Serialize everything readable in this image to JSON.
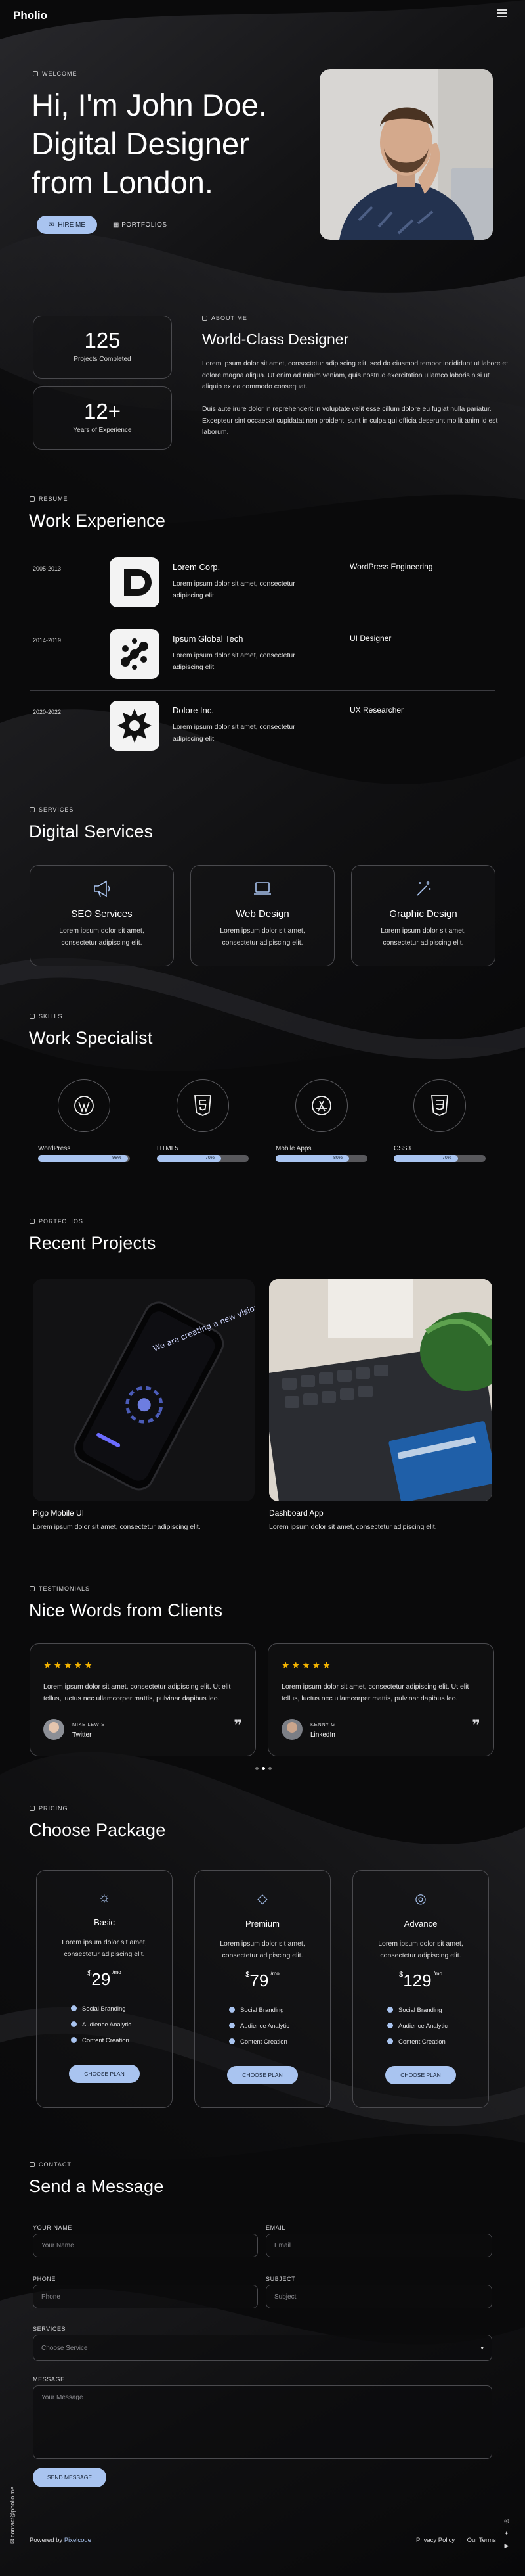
{
  "brand": "Pholio",
  "hero": {
    "label": "WELCOME",
    "line1": "Hi, I'm John Doe.",
    "line2": "Digital Designer",
    "line3": "from London.",
    "hire_btn": "HIRE ME",
    "portfolio_link": "PORTFOLIOS"
  },
  "about": {
    "label": "ABOUT ME",
    "title": "World-Class Designer",
    "stats": [
      {
        "num": "125",
        "text": "Projects Completed"
      },
      {
        "num": "12+",
        "text": "Years of Experience"
      }
    ],
    "p1": "Lorem ipsum dolor sit amet, consectetur adipiscing elit, sed do eiusmod tempor incididunt ut labore et dolore magna aliqua. Ut enim ad minim veniam, quis nostrud exercitation ullamco laboris nisi ut aliquip ex ea commodo consequat.",
    "p2": "Duis aute irure dolor in reprehenderit in voluptate velit esse cillum dolore eu fugiat nulla pariatur. Excepteur sint occaecat cupidatat non proident, sunt in culpa qui officia deserunt mollit anim id est laborum."
  },
  "resume": {
    "label": "RESUME",
    "title": "Work Experience",
    "items": [
      {
        "years": "2005-2013",
        "company": "Lorem Corp.",
        "desc": "Lorem ipsum dolor sit amet, consectetur adipiscing elit.",
        "role": "WordPress Engineering"
      },
      {
        "years": "2014-2019",
        "company": "Ipsum Global Tech",
        "desc": "Lorem ipsum dolor sit amet, consectetur adipiscing elit.",
        "role": "UI Designer"
      },
      {
        "years": "2020-2022",
        "company": "Dolore Inc.",
        "desc": "Lorem ipsum dolor sit amet, consectetur adipiscing elit.",
        "role": "UX Researcher"
      }
    ]
  },
  "services": {
    "label": "SERVICES",
    "title": "Digital Services",
    "items": [
      {
        "icon": "megaphone-icon",
        "name": "SEO Services",
        "desc": "Lorem ipsum dolor sit amet, consectetur adipiscing elit."
      },
      {
        "icon": "laptop-icon",
        "name": "Web Design",
        "desc": "Lorem ipsum dolor sit amet, consectetur adipiscing elit."
      },
      {
        "icon": "magic-wand-icon",
        "name": "Graphic Design",
        "desc": "Lorem ipsum dolor sit amet, consectetur adipiscing elit."
      }
    ]
  },
  "skills": {
    "label": "SKILLS",
    "title": "Work Specialist",
    "items": [
      {
        "icon": "wordpress-icon",
        "name": "WordPress",
        "pct": "98%",
        "value": 0.98
      },
      {
        "icon": "html5-icon",
        "name": "HTML5",
        "pct": "70%",
        "value": 0.7
      },
      {
        "icon": "app-store-icon",
        "name": "Mobile Apps",
        "pct": "80%",
        "value": 0.8
      },
      {
        "icon": "css3-icon",
        "name": "CSS3",
        "pct": "70%",
        "value": 0.7
      }
    ]
  },
  "portfolio": {
    "label": "PORTFOLIOS",
    "title": "Recent Projects",
    "items": [
      {
        "name": "Pigo Mobile UI",
        "desc": "Lorem ipsum dolor sit amet, consectetur adipiscing elit.",
        "phone_text": "We are creating a new vision for your products!"
      },
      {
        "name": "Dashboard App",
        "desc": "Lorem ipsum dolor sit amet, consectetur adipiscing elit."
      }
    ]
  },
  "testimonials": {
    "label": "TESTIMONIALS",
    "title": "Nice Words from Clients",
    "items": [
      {
        "stars": "★★★★★",
        "text": "Lorem ipsum dolor sit amet, consectetur adipiscing elit. Ut elit tellus, luctus nec ullamcorper mattis, pulvinar dapibus leo.",
        "name": "MIKE LEWIS",
        "company": "Twitter"
      },
      {
        "stars": "★★★★★",
        "text": "Lorem ipsum dolor sit amet, consectetur adipiscing elit. Ut elit tellus, luctus nec ullamcorper mattis, pulvinar dapibus leo.",
        "name": "KENNY G",
        "company": "LinkedIn"
      }
    ],
    "quote_glyph": "❞"
  },
  "pricing": {
    "label": "PRICING",
    "title": "Choose Package",
    "plans": [
      {
        "icon": "bulb-icon",
        "name": "Basic",
        "desc": "Lorem ipsum dolor sit amet, consectetur adipiscing elit.",
        "currency": "$",
        "price": "29",
        "period": "/mo",
        "features": [
          "Social Branding",
          "Audience Analytic",
          "Content Creation"
        ],
        "button": "CHOOSE PLAN"
      },
      {
        "icon": "diamond-icon",
        "name": "Premium",
        "desc": "Lorem ipsum dolor sit amet, consectetur adipiscing elit.",
        "currency": "$",
        "price": "79",
        "period": "/mo",
        "features": [
          "Social Branding",
          "Audience Analytic",
          "Content Creation"
        ],
        "button": "CHOOSE PLAN"
      },
      {
        "icon": "globe-icon",
        "name": "Advance",
        "desc": "Lorem ipsum dolor sit amet, consectetur adipiscing elit.",
        "currency": "$",
        "price": "129",
        "period": "/mo",
        "features": [
          "Social Branding",
          "Audience Analytic",
          "Content Creation"
        ],
        "button": "CHOOSE PLAN"
      }
    ]
  },
  "contact": {
    "label": "CONTACT",
    "title": "Send a Message",
    "name_label": "YOUR NAME",
    "name_ph": "Your Name",
    "email_label": "EMAIL",
    "email_ph": "Email",
    "phone_label": "PHONE",
    "phone_ph": "Phone",
    "subject_label": "SUBJECT",
    "subject_ph": "Subject",
    "services_label": "SERVICES",
    "services_ph": "Choose Service",
    "message_label": "MESSAGE",
    "message_ph": "Your Message",
    "send_btn": "SEND MESSAGE"
  },
  "sidebar_email": "contact@pholio.me",
  "footer": {
    "powered": "Powered by",
    "powered_brand": "Pixelcode",
    "links": [
      "Privacy Policy",
      "Our Terms"
    ]
  },
  "colors": {
    "accent": "#a9c4f0",
    "background": "#0b0b0c",
    "star": "#f5b400"
  }
}
